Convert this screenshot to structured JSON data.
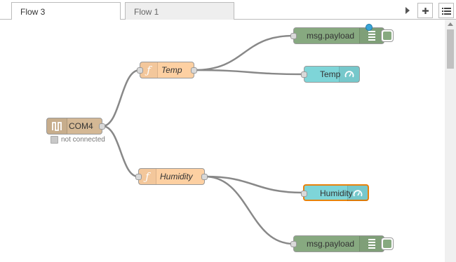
{
  "tabs": [
    {
      "label": "Flow 3",
      "active": true
    },
    {
      "label": "Flow 1",
      "active": false
    }
  ],
  "toolbar": {
    "scroll_icon": "triangle-right-icon",
    "add_icon": "plus-icon",
    "menu_icon": "list-icon"
  },
  "nodes": {
    "serial": {
      "label": "COM4",
      "icon": "serial-port-icon",
      "status": "not connected"
    },
    "func_temp": {
      "label": "Temp",
      "icon": "function-icon"
    },
    "func_humidity": {
      "label": "Humidity",
      "icon": "function-icon"
    },
    "debug_top": {
      "label": "msg.payload",
      "icon": "debug-list-icon"
    },
    "debug_bottom": {
      "label": "msg.payload",
      "icon": "debug-list-icon"
    },
    "gauge_temp": {
      "label": "Temp",
      "icon": "gauge-icon"
    },
    "gauge_humidity": {
      "label": "Humidity",
      "icon": "gauge-icon",
      "selected": true
    }
  },
  "colors": {
    "serial": "#d4b895",
    "function": "#fdd0a2",
    "debug": "#87a980",
    "gauge": "#7ed5d8",
    "selected": "#e8820c",
    "changed_dot": "#3aa5d8",
    "wire": "#888888"
  }
}
